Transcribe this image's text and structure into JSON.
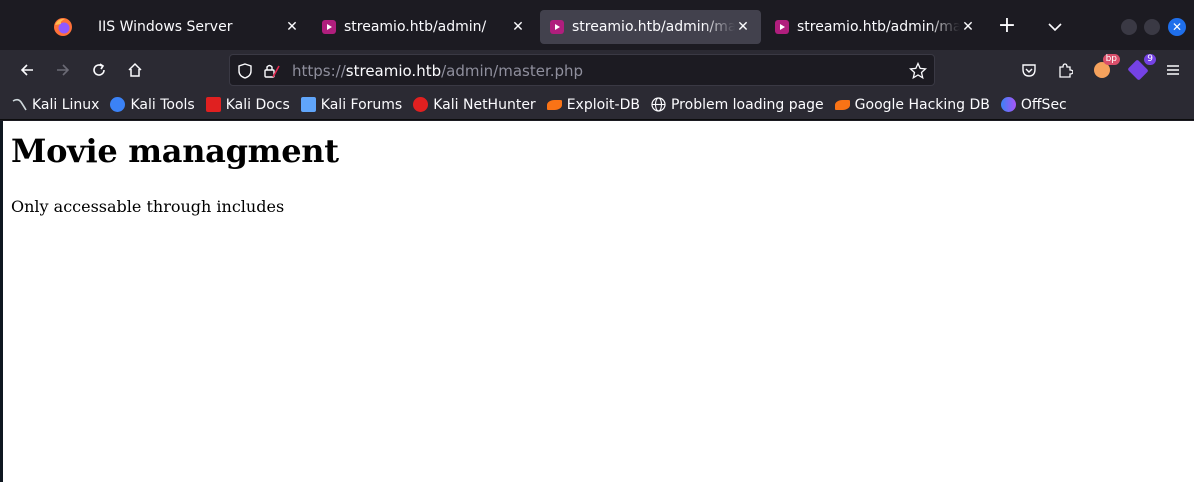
{
  "tabs": [
    {
      "title": "IIS Windows Server",
      "favicon": "none",
      "active": false
    },
    {
      "title": "streamio.htb/admin/",
      "favicon": "streamio-favicon",
      "active": false
    },
    {
      "title": "streamio.htb/admin/master.php",
      "favicon": "streamio-favicon",
      "active": true
    },
    {
      "title": "streamio.htb/admin/master.php",
      "favicon": "streamio-favicon",
      "active": false
    }
  ],
  "urlbar": {
    "scheme": "https://",
    "host": "streamio.htb",
    "path": "/admin/master.php"
  },
  "toolbar": {
    "extension_badge_bp": "bp",
    "extension_badge_count": "9"
  },
  "bookmarks": [
    {
      "label": "Kali Linux",
      "icon": "kali-linux-icon",
      "color": "#cfd8dc"
    },
    {
      "label": "Kali Tools",
      "icon": "kali-tools-icon",
      "color": "#3b82f6"
    },
    {
      "label": "Kali Docs",
      "icon": "kali-docs-icon",
      "color": "#e02020"
    },
    {
      "label": "Kali Forums",
      "icon": "kali-forums-icon",
      "color": "#60a5fa"
    },
    {
      "label": "Kali NetHunter",
      "icon": "kali-nethunter-icon",
      "color": "#e02020"
    },
    {
      "label": "Exploit-DB",
      "icon": "exploit-db-icon",
      "color": "#f97316"
    },
    {
      "label": "Problem loading page",
      "icon": "globe-icon",
      "color": "#fbfbfe"
    },
    {
      "label": "Google Hacking DB",
      "icon": "ghdb-icon",
      "color": "#f97316"
    },
    {
      "label": "OffSec",
      "icon": "offsec-icon",
      "color": "#3b82f6"
    }
  ],
  "page": {
    "heading": "Movie managment",
    "text": "Only accessable through includes"
  },
  "colors": {
    "accent": "#1f6feb",
    "tab_active_bg": "#42414d",
    "chrome_bg": "#2b2a33",
    "favicon": "#b01e7d"
  }
}
